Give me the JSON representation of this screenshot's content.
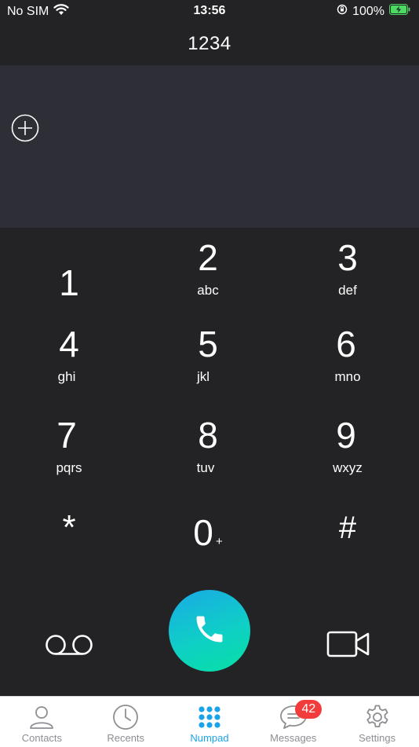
{
  "status_bar": {
    "carrier": "No SIM",
    "time": "13:56",
    "battery": "100%",
    "icons": [
      "wifi-icon",
      "orientation-lock-icon",
      "battery-charging-icon"
    ]
  },
  "dialer": {
    "number": "1234",
    "add_contact_icon": "plus-circle-icon"
  },
  "keypad": {
    "keys": [
      {
        "digit": "1",
        "letters": ""
      },
      {
        "digit": "2",
        "letters": "abc"
      },
      {
        "digit": "3",
        "letters": "def"
      },
      {
        "digit": "4",
        "letters": "ghi"
      },
      {
        "digit": "5",
        "letters": "jkl"
      },
      {
        "digit": "6",
        "letters": "mno"
      },
      {
        "digit": "7",
        "letters": "pqrs"
      },
      {
        "digit": "8",
        "letters": "tuv"
      },
      {
        "digit": "9",
        "letters": "wxyz"
      },
      {
        "digit": "*",
        "letters": ""
      },
      {
        "digit": "0",
        "letters": "+"
      },
      {
        "digit": "#",
        "letters": ""
      }
    ]
  },
  "actions": {
    "voicemail_icon": "voicemail-icon",
    "call_icon": "phone-icon",
    "video_icon": "video-camera-icon",
    "call_gradient": [
      "#1aa9e6",
      "#06e0a4"
    ]
  },
  "tab_bar": {
    "tabs": [
      {
        "label": "Contacts",
        "icon": "person-icon"
      },
      {
        "label": "Recents",
        "icon": "clock-icon"
      },
      {
        "label": "Numpad",
        "icon": "numpad-icon",
        "active": true
      },
      {
        "label": "Messages",
        "icon": "chat-bubble-icon",
        "badge": "42"
      },
      {
        "label": "Settings",
        "icon": "gear-icon"
      }
    ],
    "active_color": "#1aa3e8",
    "badge_color": "#f23b3b"
  }
}
